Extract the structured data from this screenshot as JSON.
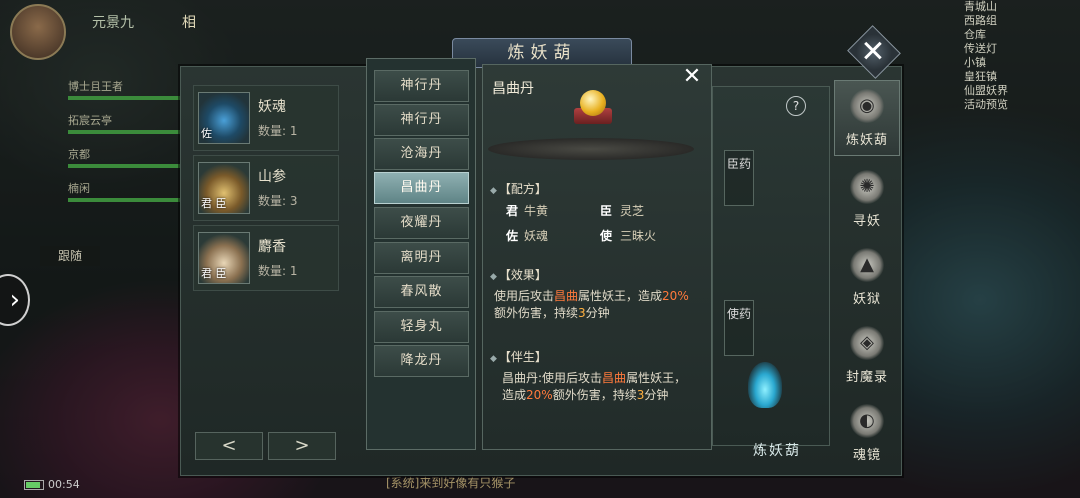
{
  "hud": {
    "player_name": "元景九",
    "title_char": "相",
    "follow_label": "跟随",
    "clock": "00:54",
    "team": [
      {
        "name": "博士且王者"
      },
      {
        "name": "拓宸云亭"
      },
      {
        "name": "京都"
      },
      {
        "name": "楠闲"
      }
    ],
    "chat_line": "[系统]来到好像有只猴子",
    "minimap_labels": [
      "青城山",
      "西路组",
      "仓库",
      "传送灯",
      "小镇",
      "皇狂镇",
      "仙盟妖界",
      "活动预览"
    ]
  },
  "window": {
    "title": "炼妖葫"
  },
  "inventory": {
    "items": [
      {
        "name": "妖魂",
        "qty_label": "数量: 1",
        "tag": "佐",
        "icon": "blue-soul-flame-icon"
      },
      {
        "name": "山参",
        "qty_label": "数量: 3",
        "tag": "君 臣",
        "icon": "ginseng-root-icon"
      },
      {
        "name": "麝香",
        "qty_label": "数量: 1",
        "tag": "君 臣",
        "icon": "musk-powder-icon"
      }
    ],
    "prev_label": "<",
    "next_label": ">"
  },
  "recipes": {
    "items": [
      "神行丹",
      "神行丹",
      "沧海丹",
      "昌曲丹",
      "夜耀丹",
      "离明丹",
      "春风散",
      "轻身丸",
      "降龙丹"
    ],
    "active_index": 3
  },
  "detail": {
    "name": "昌曲丹",
    "close_label": "✕",
    "formula_header": "【配方】",
    "formula": [
      {
        "role": "君",
        "value": "牛黄"
      },
      {
        "role": "臣",
        "value": "灵芝"
      },
      {
        "role": "佐",
        "value": "妖魂"
      },
      {
        "role": "使",
        "value": "三昧火"
      }
    ],
    "effect_header": "【效果】",
    "effect_pre": "使用后攻击",
    "effect_hl": "昌曲",
    "effect_mid": "属性妖王，造成",
    "effect_pct": "20%",
    "effect_mid2": "额外伤害，持续",
    "effect_num": "3",
    "effect_post": "分钟",
    "byproduct_header": "【伴生】",
    "byproduct_pre": "昌曲丹:使用后攻击",
    "byproduct_hl": "昌曲",
    "byproduct_mid": "属性妖王，造成",
    "byproduct_pct": "20%",
    "byproduct_mid2": "额外伤害，持续",
    "byproduct_num": "3",
    "byproduct_post": "分钟"
  },
  "cauldron": {
    "help": "?",
    "slot_chen": "臣药",
    "slot_shi": "使药",
    "refine_label": "炼妖葫"
  },
  "right_tabs": [
    {
      "label": "炼妖葫",
      "icon": "gourd-icon",
      "active": true
    },
    {
      "label": "寻妖",
      "icon": "compass-icon",
      "active": false
    },
    {
      "label": "妖狱",
      "icon": "pagoda-icon",
      "active": false
    },
    {
      "label": "封魔录",
      "icon": "demon-mask-icon",
      "active": false
    },
    {
      "label": "魂镜",
      "icon": "fox-mirror-icon",
      "active": false
    }
  ],
  "colors": {
    "highlight_name": "#ff7a3c",
    "highlight_num": "#ffb040",
    "active_recipe": "#7fa2a4"
  }
}
